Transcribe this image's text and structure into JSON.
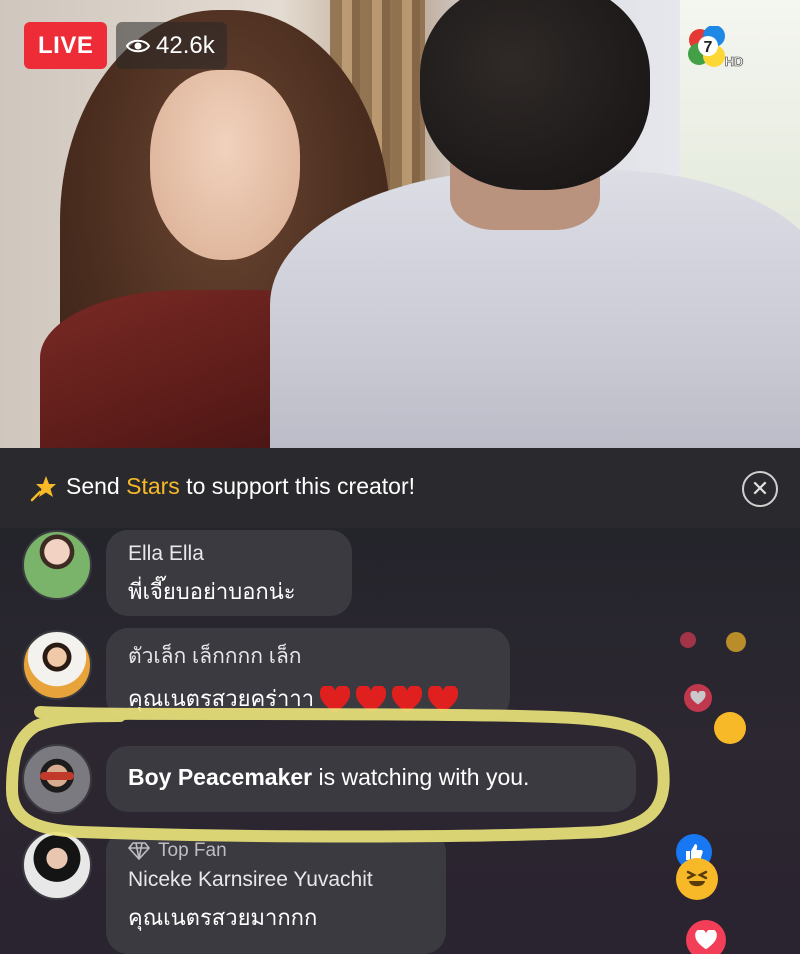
{
  "live": {
    "badge": "LIVE",
    "viewers": "42.6k"
  },
  "channel_logo": {
    "name": "channel-7-hd-logo",
    "label": "HD",
    "number": "7"
  },
  "stars_banner": {
    "prefix": "Send ",
    "highlight": "Stars",
    "suffix": " to support this creator!",
    "highlight_color": "#f7b928",
    "close_icon": "close-icon"
  },
  "comments": [
    {
      "name": "Ella Ella",
      "text": "พี่เจี๊ยบอย่าบอกน่ะ"
    },
    {
      "name": "ตัวเล็ก เล็กกกก เล็ก",
      "text": "คุณเนตรสวยคร่าาา",
      "hearts": 4
    },
    {
      "watch_name": "Boy Peacemaker",
      "watch_suffix": " is watching with you."
    },
    {
      "badge": "Top Fan",
      "name": "Niceke Karnsiree Yuvachit",
      "text": "คุณเนตรสวยมากกก"
    }
  ],
  "colors": {
    "live_red": "#ee2c38",
    "highlight_yellow": "#e9e27a",
    "like_blue": "#1877f2",
    "love_red": "#f33e58"
  }
}
